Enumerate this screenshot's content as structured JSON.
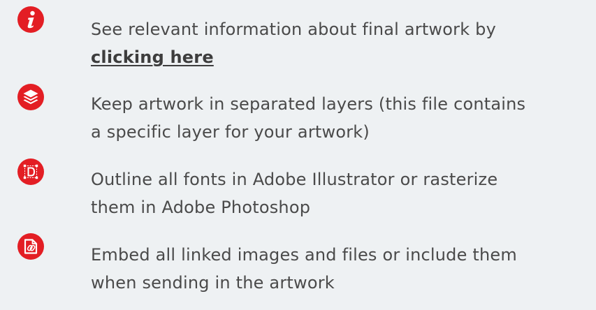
{
  "colors": {
    "background": "#eef1f3",
    "accent": "#e31e24",
    "text": "#4a4a4a"
  },
  "items": [
    {
      "icon": "info-icon",
      "line1": "See relevant information about final artwork by",
      "link": "clicking here"
    },
    {
      "icon": "layers-icon",
      "line1": "Keep artwork in separated layers (this file contains",
      "line2": "a specific layer for your artwork)"
    },
    {
      "icon": "outline-font-icon",
      "line1": "Outline all fonts in Adobe Illustrator or rasterize",
      "line2": "them in Adobe Photoshop"
    },
    {
      "icon": "embed-file-icon",
      "line1": "Embed all linked images and files or include them",
      "line2": "when sending in the artwork"
    }
  ]
}
